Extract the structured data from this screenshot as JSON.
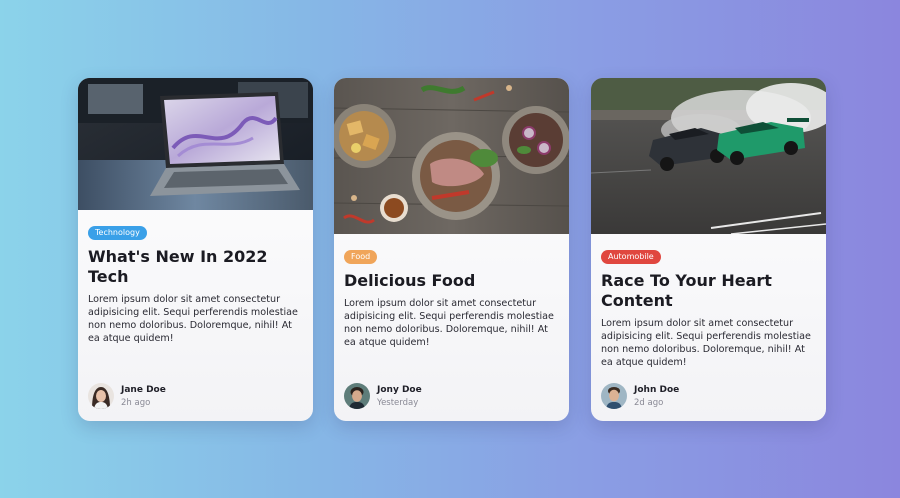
{
  "cards": [
    {
      "image_icon": "laptop-photo",
      "tag": "Technology",
      "tag_color": "#3aa0e8",
      "title": "What's New In 2022 Tech",
      "excerpt": "Lorem ipsum dolor sit amet consectetur adipisicing elit. Sequi perferendis molestiae non nemo doloribus. Doloremque, nihil! At ea atque quidem!",
      "author": {
        "name": "Jane Doe",
        "time": "2h ago"
      }
    },
    {
      "image_icon": "food-plates-photo",
      "tag": "Food",
      "tag_color": "#f0a55a",
      "title": "Delicious Food",
      "excerpt": "Lorem ipsum dolor sit amet consectetur adipisicing elit. Sequi perferendis molestiae non nemo doloribus. Doloremque, nihil! At ea atque quidem!",
      "author": {
        "name": "Jony Doe",
        "time": "Yesterday"
      }
    },
    {
      "image_icon": "drifting-cars-photo",
      "tag": "Automobile",
      "tag_color": "#e0473f",
      "title": "Race To Your Heart Content",
      "excerpt": "Lorem ipsum dolor sit amet consectetur adipisicing elit. Sequi perferendis molestiae non nemo doloribus. Doloremque, nihil! At ea atque quidem!",
      "author": {
        "name": "John Doe",
        "time": "2d ago"
      }
    }
  ]
}
